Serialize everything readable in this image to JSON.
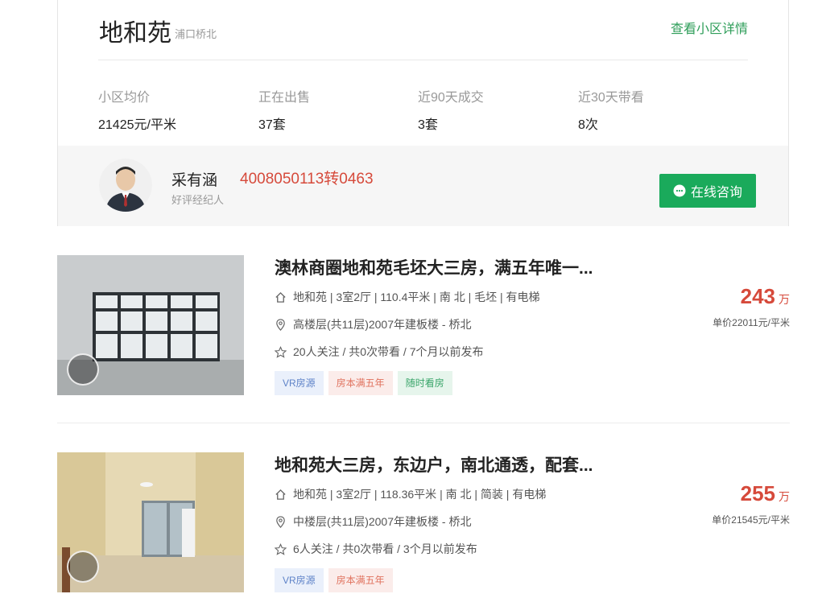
{
  "community": {
    "name": "地和苑",
    "area": "浦口桥北",
    "detail_link": "查看小区详情",
    "stats": [
      {
        "label": "小区均价",
        "value": "21425元/平米"
      },
      {
        "label": "正在出售",
        "value": "37套"
      },
      {
        "label": "近90天成交",
        "value": "3套"
      },
      {
        "label": "近30天带看",
        "value": "8次"
      }
    ]
  },
  "agent": {
    "name": "采有涵",
    "phone": "4008050113转0463",
    "tag": "好评经纪人",
    "consult_label": "在线咨询"
  },
  "listings": [
    {
      "title": "澳林商圈地和苑毛坯大三房，满五年唯一...",
      "house_info": "地和苑 | 3室2厅 | 110.4平米 | 南 北 | 毛坯 | 有电梯",
      "position_info": "高楼层(共11层)2007年建板楼 - 桥北",
      "follow_info": "20人关注 / 共0次带看 / 7个月以前发布",
      "tags": [
        "VR房源",
        "房本满五年",
        "随时看房"
      ],
      "price": "243",
      "price_unit": "万",
      "unit_price": "单价22011元/平米"
    },
    {
      "title": "地和苑大三房，东边户，南北通透，配套...",
      "house_info": "地和苑 | 3室2厅 | 118.36平米 | 南 北 | 简装 | 有电梯",
      "position_info": "中楼层(共11层)2007年建板楼 - 桥北",
      "follow_info": "6人关注 / 共0次带看 / 3个月以前发布",
      "tags": [
        "VR房源",
        "房本满五年"
      ],
      "price": "255",
      "price_unit": "万",
      "unit_price": "单价21545元/平米"
    }
  ],
  "colors": {
    "accent_green": "#1aaa5b",
    "price_red": "#d64a3b",
    "link_green": "#2f9e5a"
  }
}
